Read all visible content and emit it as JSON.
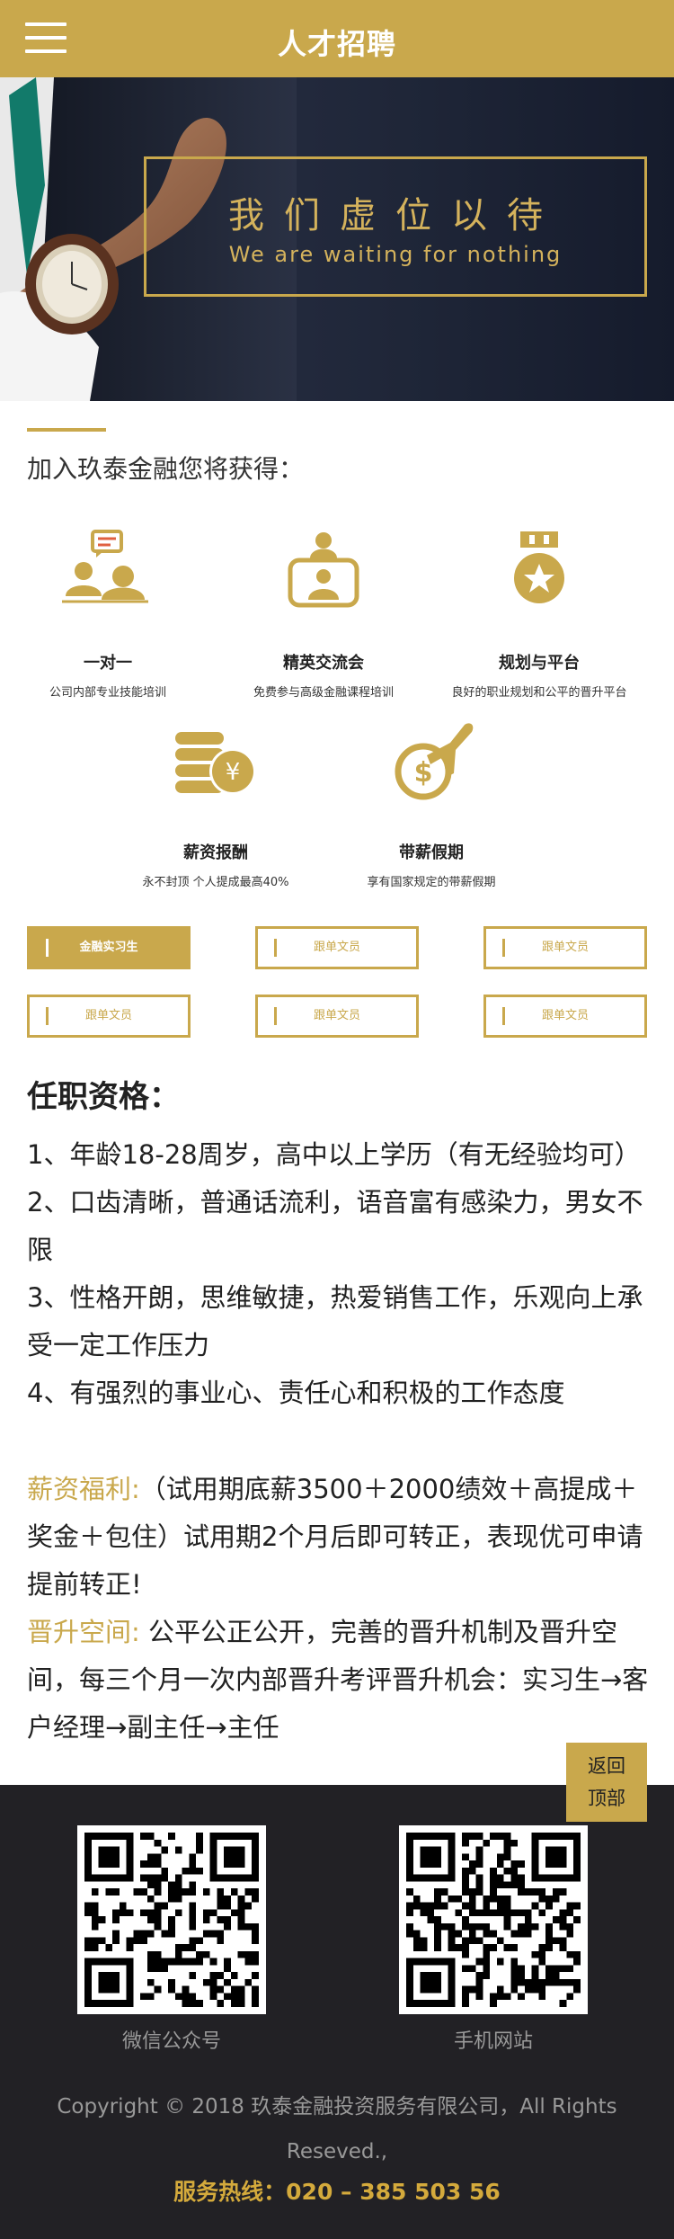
{
  "header": {
    "title": "人才招聘"
  },
  "banner": {
    "title": "我们虚位以待",
    "subtitle": "We are waiting for nothing"
  },
  "intro": "加入玖泰金融您将获得：",
  "benefits": [
    {
      "title": "一对一",
      "desc": "公司内部专业技能培训",
      "icon": "one-on-one-icon"
    },
    {
      "title": "精英交流会",
      "desc": "免费参与高级金融课程培训",
      "icon": "elite-exchange-icon"
    },
    {
      "title": "规划与平台",
      "desc": "良好的职业规划和公平的晋升平台",
      "icon": "medal-icon"
    },
    {
      "title": "薪资报酬",
      "desc": "永不封顶 个人提成最高40%",
      "icon": "coins-icon"
    },
    {
      "title": "带薪假期",
      "desc": "享有国家规定的带薪假期",
      "icon": "travel-plane-icon"
    }
  ],
  "positions": [
    "金融实习生",
    "跟单文员",
    "跟单文员",
    "跟单文员",
    "跟单文员",
    "跟单文员"
  ],
  "requirements": {
    "title": "任职资格：",
    "items": [
      "1、年龄18-28周岁，高中以上学历（有无经验均可）",
      "2、口齿清晰，普通话流利，语音富有感染力，男女不限",
      "3、性格开朗，思维敏捷，热爱销售工作，乐观向上承受一定工作压力",
      "4、有强烈的事业心、责任心和积极的工作态度"
    ]
  },
  "salary": {
    "label": "薪资福利:",
    "text": "（试用期底薪3500＋2000绩效＋高提成＋奖金＋包住）试用期2个月后即可转正，表现优可申请提前转正!"
  },
  "promotion": {
    "label": "晋升空间:",
    "text": " 公平公正公开，完善的晋升机制及晋升空间，每三个月一次内部晋升考评晋升机会：实习生→客户经理→副主任→主任"
  },
  "back_top": {
    "line1": "返回",
    "line2": "顶部"
  },
  "footer": {
    "qr1_label": "微信公众号",
    "qr2_label": "手机网站",
    "copyright": "Copyright © 2018 玖泰金融投资服务有限公司，All Rights Reseved.,",
    "hotline": "服务热线：020 – 385 503 56"
  },
  "colors": {
    "gold": "#c9a84c",
    "dark": "#222125",
    "banner": "#1c2335"
  }
}
